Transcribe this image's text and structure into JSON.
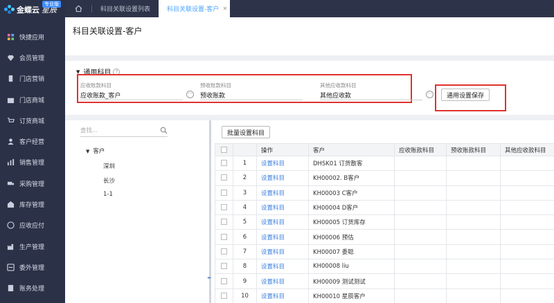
{
  "brand": {
    "name": "金蝶云",
    "sub": "星辰",
    "badge": "专业版"
  },
  "sidebar": {
    "items": [
      {
        "label": "快捷应用",
        "icon": "grid-icon"
      },
      {
        "label": "会员管理",
        "icon": "diamond-icon"
      },
      {
        "label": "门店营销",
        "icon": "phone-icon"
      },
      {
        "label": "门店商城",
        "icon": "shop-icon"
      },
      {
        "label": "订货商城",
        "icon": "cart-icon"
      },
      {
        "label": "客户经营",
        "icon": "user-icon"
      },
      {
        "label": "销售管理",
        "icon": "chart-icon"
      },
      {
        "label": "采购管理",
        "icon": "truck-icon"
      },
      {
        "label": "库存管理",
        "icon": "warehouse-icon"
      },
      {
        "label": "应收应付",
        "icon": "money-icon"
      },
      {
        "label": "生产管理",
        "icon": "factory-icon"
      },
      {
        "label": "委外管理",
        "icon": "outsource-icon"
      },
      {
        "label": "账务处理",
        "icon": "ledger-icon"
      }
    ]
  },
  "tabs": [
    {
      "label": "科目关联设置列表"
    },
    {
      "label": "科目关联设置-客户"
    }
  ],
  "page_title": "科目关联设置-客户",
  "general": {
    "title": "通用科目",
    "fields": [
      {
        "label": "应收账款科目",
        "value": "应收账款_客户"
      },
      {
        "label": "预收账款科目",
        "value": "预收账款"
      },
      {
        "label": "其他应收款科目",
        "value": "其他应收款"
      }
    ],
    "save_label": "通用设置保存"
  },
  "tree": {
    "search_placeholder": "查找...",
    "root": "客户",
    "children": [
      "深圳",
      "长沙",
      "1-1"
    ]
  },
  "table": {
    "batch_label": "批量设置科目",
    "headers": [
      "操作",
      "客户",
      "应收账款科目",
      "预收账款科目",
      "其他应收款科目"
    ],
    "rows": [
      {
        "no": "1",
        "action": "设置科目",
        "customer": "DHSK01  订货散客"
      },
      {
        "no": "2",
        "action": "设置科目",
        "customer": "KH00002.  B客户"
      },
      {
        "no": "3",
        "action": "设置科目",
        "customer": "KH00003  C客户"
      },
      {
        "no": "4",
        "action": "设置科目",
        "customer": "KH00004  D客户"
      },
      {
        "no": "5",
        "action": "设置科目",
        "customer": "KH00005  订货库存"
      },
      {
        "no": "6",
        "action": "设置科目",
        "customer": "KH00006  预估"
      },
      {
        "no": "7",
        "action": "设置科目",
        "customer": "KH00007  委聪"
      },
      {
        "no": "8",
        "action": "设置科目",
        "customer": "KH00008  liu"
      },
      {
        "no": "9",
        "action": "设置科目",
        "customer": "KH00009  测试测试"
      },
      {
        "no": "10",
        "action": "设置科目",
        "customer": "KH00010  星辰客户"
      }
    ]
  }
}
